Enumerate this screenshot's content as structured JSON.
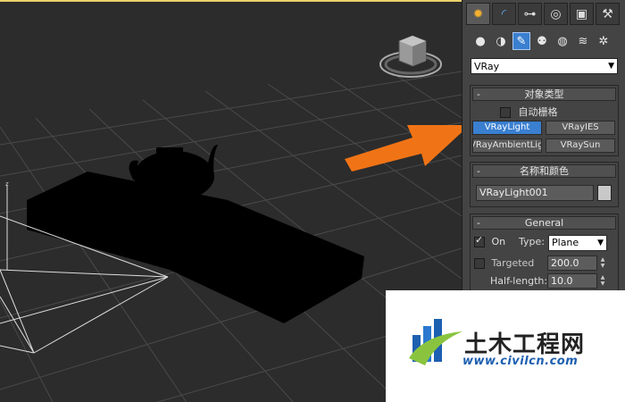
{
  "command_panel": {
    "tabs": [
      {
        "name": "create-tab",
        "glyph": "✹"
      },
      {
        "name": "modify-tab",
        "glyph": "◜"
      },
      {
        "name": "hierarchy-tab",
        "glyph": "⊶"
      },
      {
        "name": "motion-tab",
        "glyph": "◎"
      },
      {
        "name": "display-tab",
        "glyph": "▣"
      },
      {
        "name": "utilities-tab",
        "glyph": "⚒"
      }
    ],
    "subcategories": [
      {
        "name": "geometry-icon",
        "glyph": "●"
      },
      {
        "name": "shapes-icon",
        "glyph": "◑"
      },
      {
        "name": "lights-icon",
        "glyph": "✎"
      },
      {
        "name": "cameras-icon",
        "glyph": "⚉"
      },
      {
        "name": "helpers-icon",
        "glyph": "◍"
      },
      {
        "name": "space-warps-icon",
        "glyph": "≋"
      },
      {
        "name": "systems-icon",
        "glyph": "✲"
      }
    ],
    "category_dropdown": "VRay"
  },
  "object_type": {
    "title": "对象类型",
    "autogrid_label": "自动栅格",
    "buttons": [
      "VRayLight",
      "VRayIES",
      "VRayAmbientLight",
      "VRaySun"
    ]
  },
  "name_color": {
    "title": "名称和颜色",
    "name_value": "VRayLight001",
    "swatch_color": "#c8c8c8"
  },
  "general": {
    "title": "General",
    "on_label": "On",
    "type_label": "Type:",
    "type_value": "Plane",
    "targeted_label": "Targeted",
    "targeted_value": "200.0",
    "half_length_label": "Half-length:",
    "half_length_value": "10.0"
  },
  "viewport": {
    "axis_label": "z"
  },
  "watermark": {
    "title": "土木工程网",
    "url": "www.civilcn.com"
  },
  "colors": {
    "active_blue": "#3a7fd0",
    "arrow_orange": "#f07416"
  }
}
